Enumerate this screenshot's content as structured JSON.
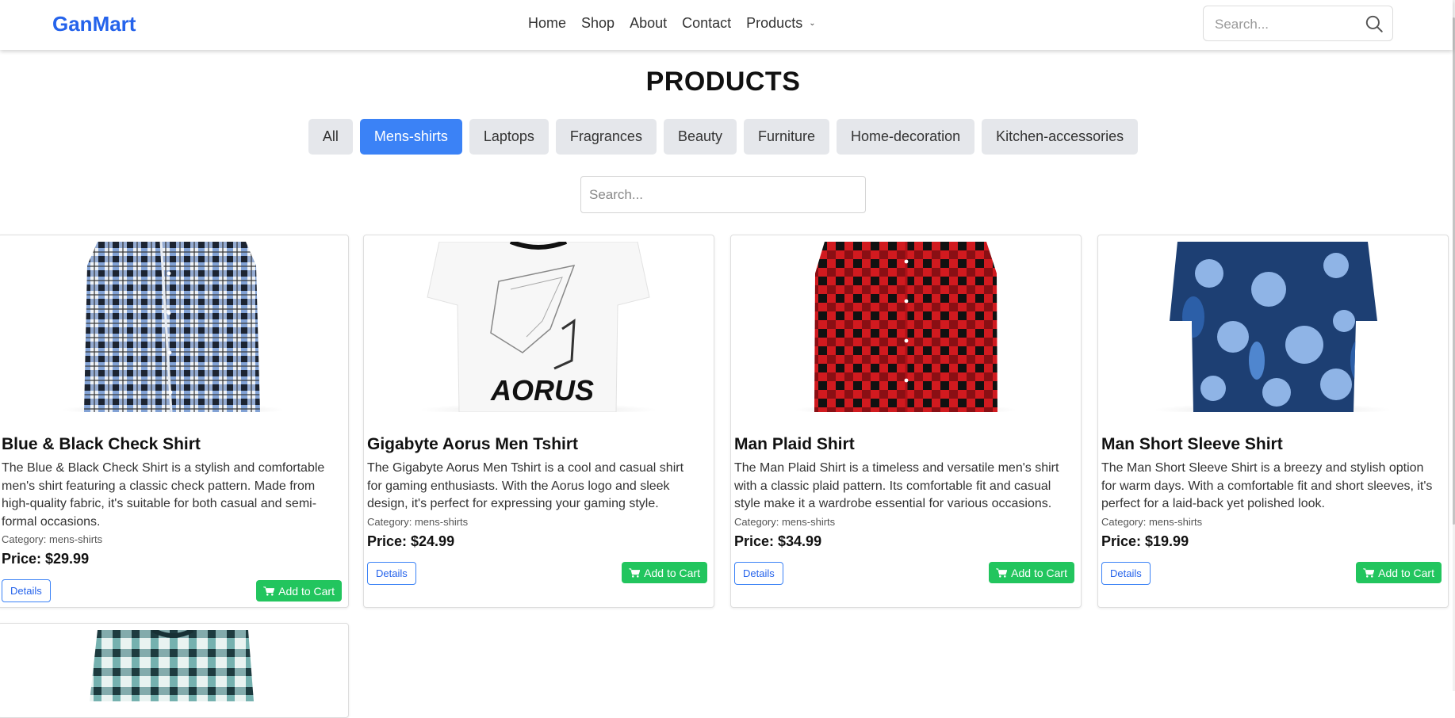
{
  "header": {
    "brand": "GanMart",
    "nav": [
      "Home",
      "Shop",
      "About",
      "Contact",
      "Products"
    ],
    "search_placeholder": "Search..."
  },
  "main": {
    "title": "PRODUCTS",
    "filters": [
      "All",
      "Mens-shirts",
      "Laptops",
      "Fragrances",
      "Beauty",
      "Furniture",
      "Home-decoration",
      "Kitchen-accessories"
    ],
    "active_filter": "Mens-shirts",
    "search_placeholder": "Search...",
    "details_label": "Details",
    "cart_label": "Add to Cart",
    "products": [
      {
        "title": "Blue & Black Check Shirt",
        "description": "The Blue & Black Check Shirt is a stylish and comfortable men's shirt featuring a classic check pattern. Made from high-quality fabric, it's suitable for both casual and semi-formal occasions.",
        "category": "Category: mens-shirts",
        "price": "Price: $29.99"
      },
      {
        "title": "Gigabyte Aorus Men Tshirt",
        "description": "The Gigabyte Aorus Men Tshirt is a cool and casual shirt for gaming enthusiasts. With the Aorus logo and sleek design, it's perfect for expressing your gaming style.",
        "category": "Category: mens-shirts",
        "price": "Price: $24.99"
      },
      {
        "title": "Man Plaid Shirt",
        "description": "The Man Plaid Shirt is a timeless and versatile men's shirt with a classic plaid pattern. Its comfortable fit and casual style make it a wardrobe essential for various occasions.",
        "category": "Category: mens-shirts",
        "price": "Price: $34.99"
      },
      {
        "title": "Man Short Sleeve Shirt",
        "description": "The Man Short Sleeve Shirt is a breezy and stylish option for warm days. With a comfortable fit and short sleeves, it's perfect for a laid-back yet polished look.",
        "category": "Category: mens-shirts",
        "price": "Price: $19.99"
      }
    ],
    "image_logo_text": "AORUS"
  },
  "colors": {
    "brand": "#2563eb",
    "active_filter": "#3b82f6",
    "cart_button": "#22c55e"
  },
  "icons": [
    "search-icon",
    "chevron-down-icon",
    "cart-icon"
  ]
}
